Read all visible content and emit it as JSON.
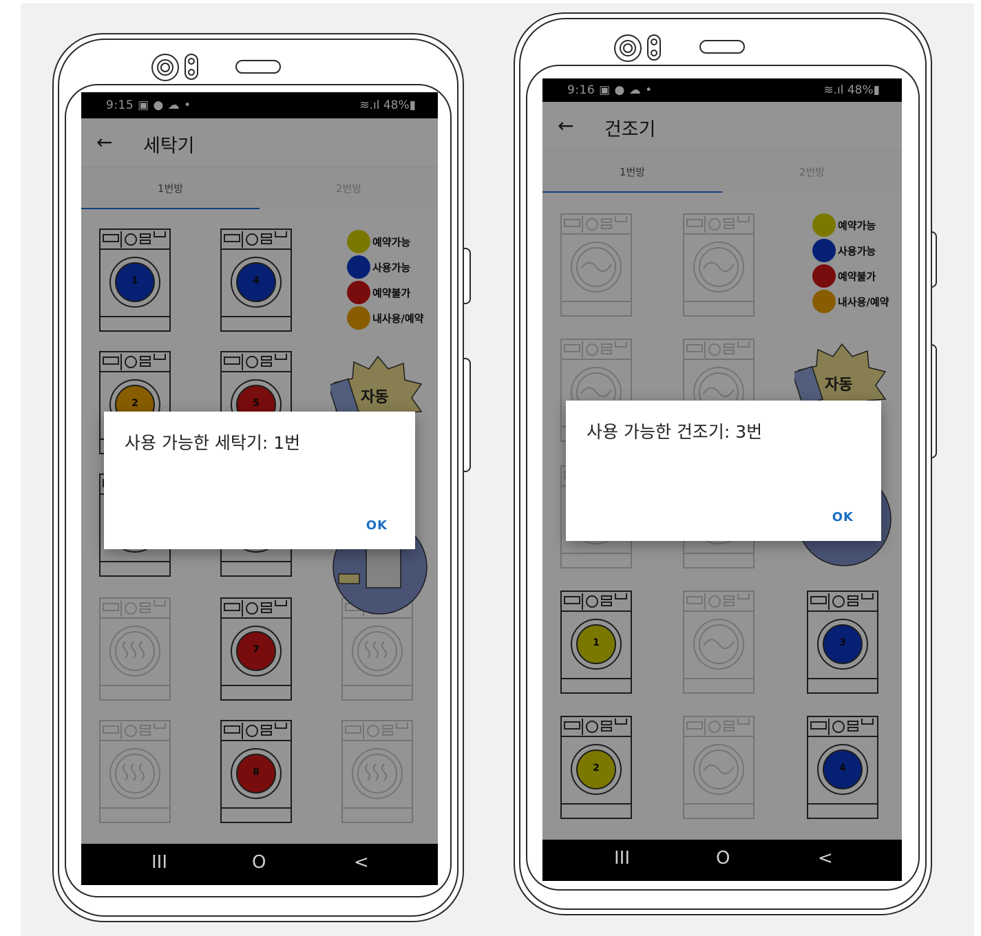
{
  "phones": [
    {
      "status": {
        "time": "9:15 ▣ ● ☁ •",
        "right": "≋.ıl 48%▮"
      },
      "appbar": {
        "back": "←",
        "title": "세탁기"
      },
      "tabs": [
        {
          "label": "1번방"
        },
        {
          "label": "2번방"
        }
      ],
      "legend": [
        {
          "label": "예약가능",
          "color": "#d4cf00"
        },
        {
          "label": "사용가능",
          "color": "#0b37c9"
        },
        {
          "label": "예약불가",
          "color": "#d01515"
        },
        {
          "label": "내사용/예약",
          "color": "#e8a000"
        }
      ],
      "sticker": {
        "text": "자동"
      },
      "machines": [
        {
          "num": "1",
          "color": "#0b37c9",
          "active": true
        },
        {
          "num": "4",
          "color": "#0b37c9",
          "active": true
        },
        {
          "num": "2",
          "color": "#e8a000",
          "active": true
        },
        {
          "num": "5",
          "color": "#d01515",
          "active": true
        },
        {
          "num": "",
          "color": "",
          "active": true
        },
        {
          "num": "",
          "color": "",
          "active": true
        },
        {
          "num": "",
          "color": "",
          "active": false
        },
        {
          "num": "7",
          "color": "#d01515",
          "active": true
        },
        {
          "num": "",
          "color": "",
          "active": false
        },
        {
          "num": "",
          "color": "",
          "active": false
        },
        {
          "num": "8",
          "color": "#d01515",
          "active": true
        },
        {
          "num": "",
          "color": "",
          "active": false
        }
      ],
      "dialog": {
        "message": "사용 가능한 세탁기: 1번",
        "ok": "OK"
      },
      "nav": {
        "recent": "III",
        "home": "O",
        "back": "<"
      }
    },
    {
      "status": {
        "time": "9:16 ▣ ● ☁ •",
        "right": "≋.ıl 48%▮"
      },
      "appbar": {
        "back": "←",
        "title": "건조기"
      },
      "tabs": [
        {
          "label": "1번방"
        },
        {
          "label": "2번방"
        }
      ],
      "legend": [
        {
          "label": "예약가능",
          "color": "#d4cf00"
        },
        {
          "label": "사용가능",
          "color": "#0b37c9"
        },
        {
          "label": "예약불가",
          "color": "#d01515"
        },
        {
          "label": "내사용/예약",
          "color": "#e8a000"
        }
      ],
      "sticker": {
        "text": "자동"
      },
      "machines": [
        {
          "num": "",
          "color": "",
          "active": false
        },
        {
          "num": "",
          "color": "",
          "active": false
        },
        {
          "num": "",
          "color": "",
          "active": false
        },
        {
          "num": "",
          "color": "",
          "active": false
        },
        {
          "num": "",
          "color": "",
          "active": false
        },
        {
          "num": "",
          "color": "",
          "active": false
        },
        {
          "num": "1",
          "color": "#d4cf00",
          "active": true
        },
        {
          "num": "",
          "color": "",
          "active": false
        },
        {
          "num": "3",
          "color": "#0b37c9",
          "active": true
        },
        {
          "num": "2",
          "color": "#d4cf00",
          "active": true
        },
        {
          "num": "",
          "color": "",
          "active": false
        },
        {
          "num": "4",
          "color": "#0b37c9",
          "active": true
        }
      ],
      "dialog": {
        "message": "사용 가능한 건조기: 3번",
        "ok": "OK"
      },
      "nav": {
        "recent": "III",
        "home": "O",
        "back": "<"
      }
    }
  ]
}
